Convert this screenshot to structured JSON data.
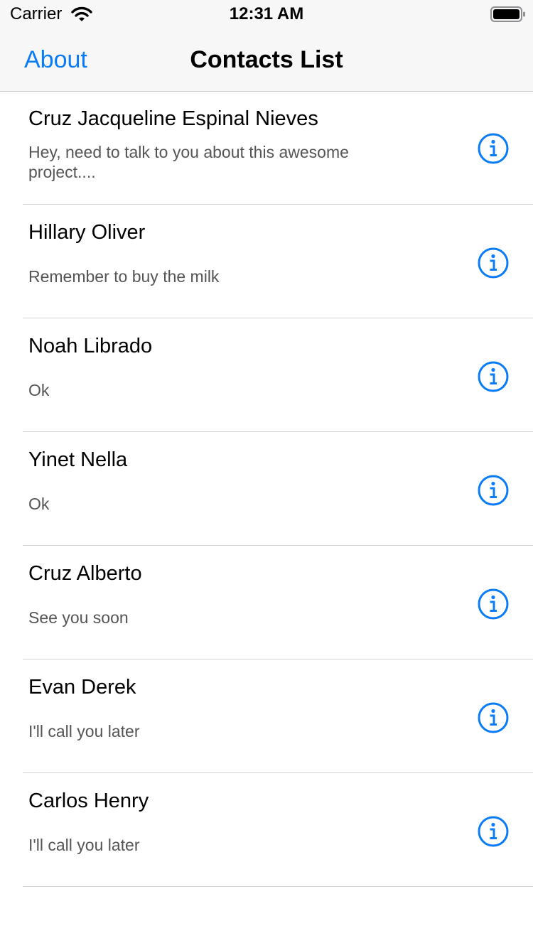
{
  "status_bar": {
    "carrier": "Carrier",
    "time": "12:31 AM"
  },
  "nav": {
    "back_label": "About",
    "title": "Contacts List"
  },
  "contacts": [
    {
      "name": "Cruz Jacqueline Espinal Nieves",
      "message": "Hey, need to talk to you about this awesome project...."
    },
    {
      "name": "Hillary Oliver",
      "message": "Remember to buy the milk"
    },
    {
      "name": "Noah Librado",
      "message": "Ok"
    },
    {
      "name": "Yinet Nella",
      "message": "Ok"
    },
    {
      "name": "Cruz Alberto",
      "message": "See you soon"
    },
    {
      "name": "Evan Derek",
      "message": "I'll call you later"
    },
    {
      "name": "Carlos Henry",
      "message": "I'll call you later"
    }
  ],
  "icons": {
    "info": "info-circle-icon",
    "wifi": "wifi-icon",
    "battery": "battery-icon"
  },
  "colors": {
    "accent": "#0a7cf5",
    "secondary_text": "#555555",
    "bar_background": "#f7f7f7",
    "separator": "#d1d1d6"
  }
}
